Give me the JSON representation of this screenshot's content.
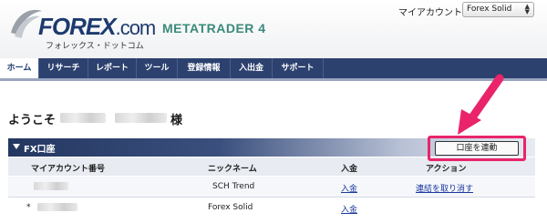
{
  "header": {
    "logo_word": "FOREX",
    "logo_dotcom": ".com",
    "logo_sub": "フォレックス・ドットコム",
    "product": "METATRADER 4",
    "account_label": "マイアカウント",
    "account_selected": "Forex Solid"
  },
  "nav": {
    "items": [
      "ホーム",
      "リサーチ",
      "レポート",
      "ツール",
      "登録情報",
      "入出金",
      "サポート"
    ],
    "active_index": 0
  },
  "welcome": {
    "prefix": "ようこそ",
    "suffix": "様"
  },
  "section": {
    "title": "FX口座",
    "link_button": "口座を連動"
  },
  "table": {
    "headers": [
      "マイアカウント番号",
      "ニックネーム",
      "入金",
      "アクション"
    ],
    "rows": [
      {
        "marker": "",
        "nickname": "SCH Trend",
        "deposit": "入金",
        "action": "連結を取り消す"
      },
      {
        "marker": "*",
        "nickname": "Forex Solid",
        "deposit": "入金",
        "action": ""
      }
    ]
  },
  "colors": {
    "nav_bg": "#2c416e",
    "brand_blue": "#1d3a6e",
    "mt4_green": "#3a8a7a",
    "highlight_pink": "#e9246a"
  }
}
